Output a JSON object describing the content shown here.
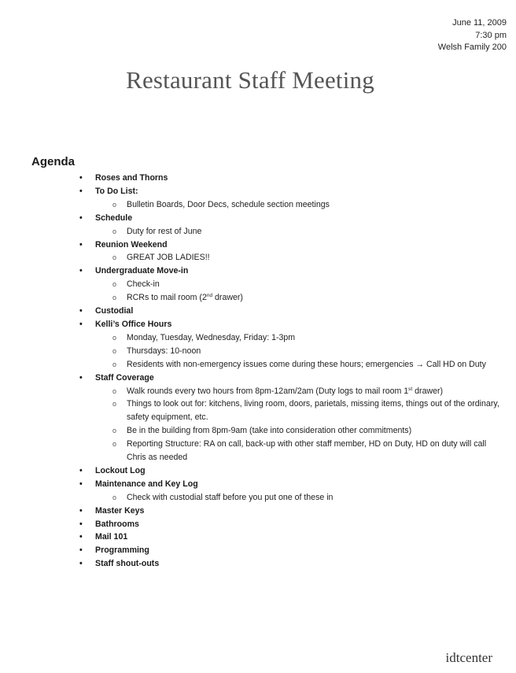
{
  "header": {
    "date": "June 11, 2009",
    "time": "7:30 pm",
    "location": "Welsh Family 200"
  },
  "title": "Restaurant Staff Meeting",
  "agenda": {
    "heading": "Agenda",
    "items": [
      {
        "label": "Roses and Thorns",
        "subitems": []
      },
      {
        "label": "To Do List:",
        "subitems": [
          "Bulletin Boards, Door Decs, schedule section meetings"
        ]
      },
      {
        "label": "Schedule",
        "subitems": [
          "Duty for rest of June"
        ]
      },
      {
        "label": "Reunion Weekend",
        "subitems": [
          "GREAT JOB LADIES!!"
        ]
      },
      {
        "label": "Undergraduate Move-in",
        "subitems": [
          "Check-in",
          "RCRs to mail room (2nd drawer)"
        ]
      },
      {
        "label": "Custodial",
        "subitems": []
      },
      {
        "label": "Kelli’s Office Hours",
        "subitems": [
          "Monday, Tuesday, Wednesday, Friday: 1-3pm",
          "Thursdays: 10-noon",
          "Residents with non-emergency issues come during these hours; emergencies → Call HD on Duty"
        ]
      },
      {
        "label": "Staff Coverage",
        "subitems": [
          "Walk rounds every two hours from 8pm-12am/2am (Duty logs to mail room 1st drawer)",
          "Things to look out for: kitchens, living room, doors, parietals, missing items, things out of the ordinary, safety equipment, etc.",
          "Be in the building from 8pm-9am (take into consideration other commitments)",
          "Reporting Structure: RA on call, back-up with other staff member, HD on Duty, HD on duty will call Chris as needed"
        ]
      },
      {
        "label": "Lockout Log",
        "subitems": []
      },
      {
        "label": "Maintenance and Key Log",
        "subitems": [
          "Check with custodial staff before you put one of these in"
        ]
      },
      {
        "label": "Master Keys",
        "subitems": []
      },
      {
        "label": "Bathrooms",
        "subitems": []
      },
      {
        "label": "Mail 101",
        "subitems": []
      },
      {
        "label": "Programming",
        "subitems": []
      },
      {
        "label": "Staff shout-outs",
        "subitems": []
      }
    ],
    "superscripts": {
      "rcrs_prefix": "RCRs to mail room (2",
      "rcrs_sup": "nd",
      "rcrs_suffix": " drawer)",
      "walk_prefix": "Walk rounds every two hours from 8pm-12am/2am (Duty logs to mail room 1",
      "walk_sup": "st",
      "walk_suffix": " drawer)"
    },
    "bullet_glyph": "•",
    "sub_bullet_glyph": "o"
  },
  "watermark": "idtcenter"
}
